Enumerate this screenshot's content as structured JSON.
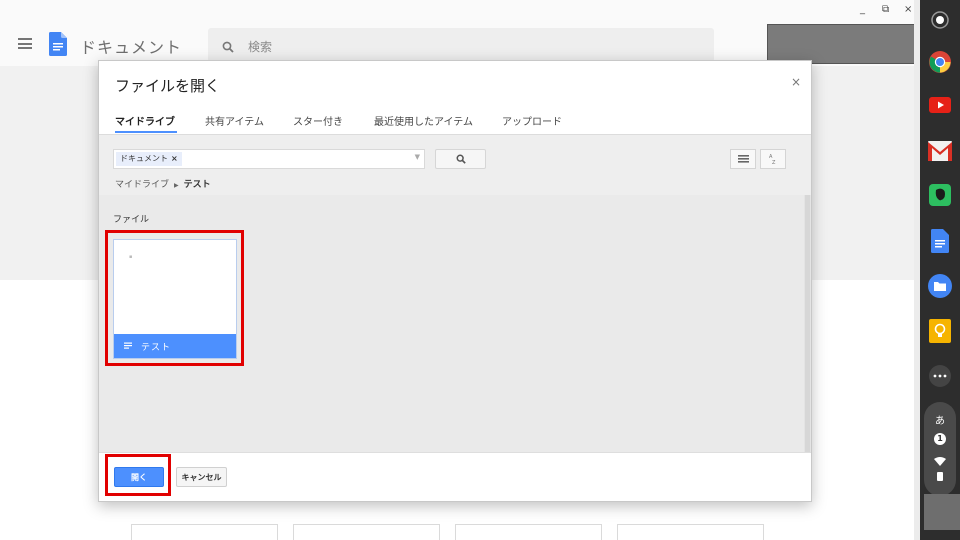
{
  "app": {
    "name": "ドキュメント",
    "search_placeholder": "検索"
  },
  "window_controls": [
    "_",
    "⧉",
    "×"
  ],
  "dialog": {
    "title": "ファイルを開く",
    "close": "×",
    "tabs": [
      {
        "label": "マイドライブ",
        "active": true
      },
      {
        "label": "共有アイテム",
        "active": false
      },
      {
        "label": "スター付き",
        "active": false
      },
      {
        "label": "最近使用したアイテム",
        "active": false
      },
      {
        "label": "アップロード",
        "active": false
      }
    ],
    "filter_chip": "ドキュメント",
    "filter_chip_remove": "×",
    "breadcrumb": {
      "root": "マイドライブ",
      "current": "テスト"
    },
    "section_label": "ファイル",
    "files": [
      {
        "name": "テスト",
        "selected": true
      }
    ],
    "open_label": "開く",
    "cancel_label": "キャンセル"
  },
  "shelf": {
    "apps": [
      "launcher-icon",
      "chrome-icon",
      "youtube-icon",
      "gmail-icon",
      "evernote-icon",
      "docs-icon",
      "files-icon",
      "keep-icon",
      "more-apps-icon"
    ],
    "ime_label": "あ",
    "notification_count": "1"
  },
  "colors": {
    "accent": "#4d90fe",
    "highlight": "#e10000",
    "shelf": "#2d2d2d"
  }
}
